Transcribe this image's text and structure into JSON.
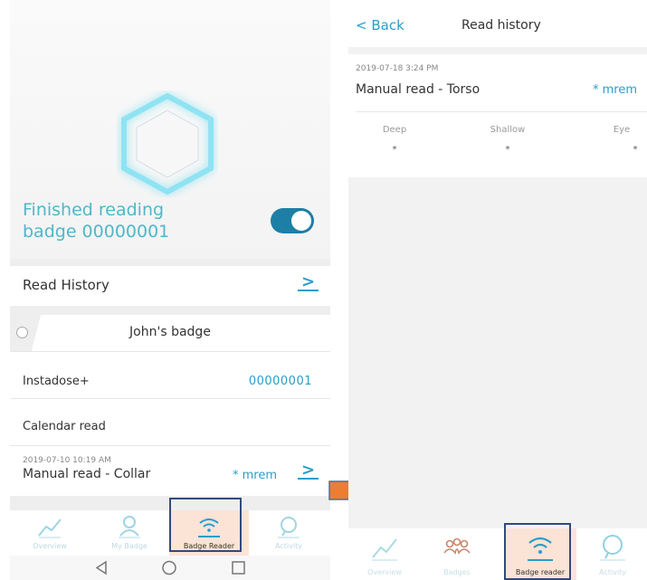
{
  "left_screen": {
    "status_line1": "Finished reading",
    "status_line2": "badge 00000001",
    "toggle_on": true,
    "read_history_label": "Read History",
    "badge_title": "John's badge",
    "device_label": "Instadose+",
    "device_serial": "00000001",
    "calendar_read_label": "Calendar read",
    "last_read": {
      "timestamp": "2019-07-10 10:19 AM",
      "title": "Manual read - Collar",
      "value": "* mrem"
    },
    "nav": [
      {
        "label": "Overview",
        "icon": "chart-line-icon"
      },
      {
        "label": "My Badge",
        "icon": "person-icon"
      },
      {
        "label": "Badge Reader",
        "icon": "wifi-icon"
      },
      {
        "label": "Activity",
        "icon": "chat-bubble-icon"
      }
    ],
    "system_buttons": [
      "back-triangle-icon",
      "home-circle-icon",
      "recents-square-icon"
    ]
  },
  "right_screen": {
    "back_label": "Back",
    "title": "Read history",
    "entry": {
      "timestamp": "2019-07-18 3:24 PM",
      "title": "Manual read - Torso",
      "value": "* mrem",
      "columns": [
        {
          "label": "Deep",
          "value": "*"
        },
        {
          "label": "Shallow",
          "value": "*"
        },
        {
          "label": "Eye",
          "value": "*"
        }
      ]
    },
    "nav": [
      {
        "label": "Overview",
        "icon": "chart-line-icon"
      },
      {
        "label": "Badges",
        "icon": "group-icon"
      },
      {
        "label": "Badge reader",
        "icon": "wifi-icon"
      },
      {
        "label": "Activity",
        "icon": "chat-bubble-icon"
      }
    ]
  },
  "colors": {
    "accent": "#2a9dc9",
    "highlight_border": "#2f4b7c",
    "highlight_fill": "#fbe3d6",
    "arrow": "#ed7d31"
  }
}
